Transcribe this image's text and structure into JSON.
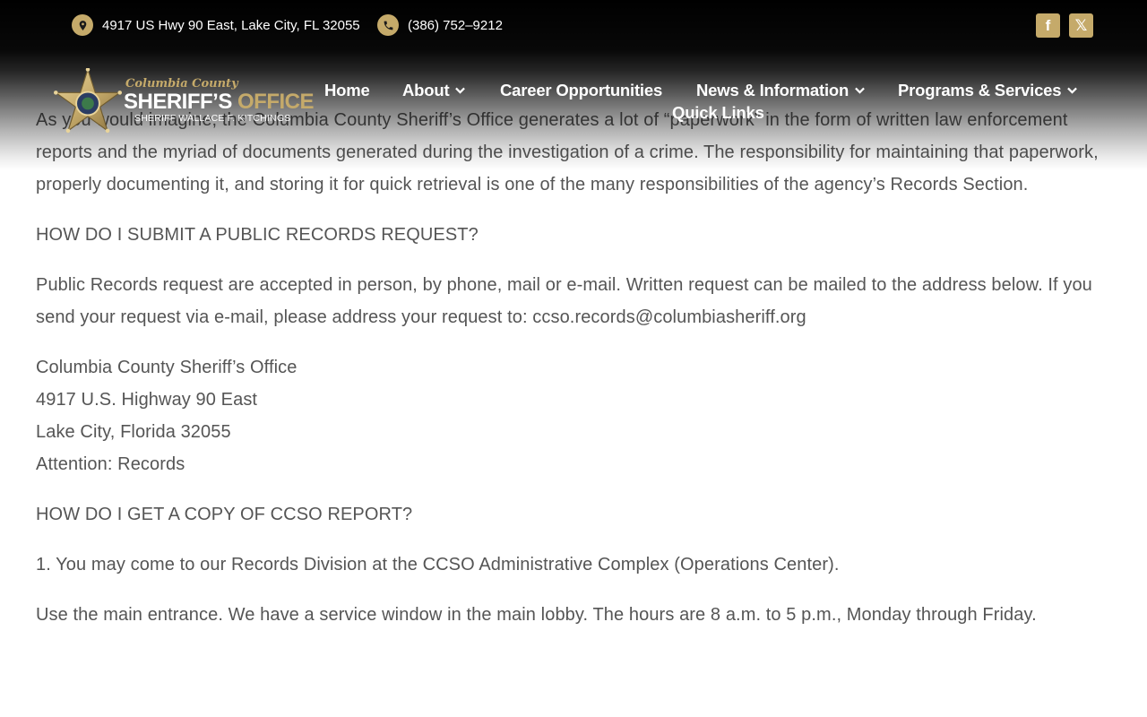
{
  "topbar": {
    "address": "4917 US Hwy 90 East, Lake City, FL 32055",
    "phone": "(386) 752–9212",
    "social": {
      "facebook": "f",
      "x": "𝕏"
    }
  },
  "logo": {
    "county": "Columbia County",
    "office_a": "SHERIFF’S ",
    "office_b": "OFFICE",
    "sheriff": "SHERIFF WALLACE F. KITCHINGS"
  },
  "nav": {
    "home": "Home",
    "about": "About",
    "career": "Career Opportunities",
    "news": "News & Information",
    "programs": "Programs & Services",
    "quick": "Quick Links"
  },
  "content": {
    "intro": "As you would imagine, the Columbia County Sheriff’s Office generates a lot of “paperwork” in the form of written law enforcement reports and the myriad of documents generated during the investigation of a crime. The responsibility for maintaining that paperwork, properly documenting it, and storing it for quick retrieval is one of the many responsibilities of the agency’s Records Section.",
    "q1": "HOW DO I SUBMIT A PUBLIC RECORDS REQUEST?",
    "a1": "Public Records request are accepted in person, by phone, mail or e-mail. Written request can be mailed to the address below. If you send your request via e-mail, please address your request to: ccso.records@columbiasheriff.org",
    "address": {
      "line1": "Columbia County Sheriff’s Office",
      "line2": "4917 U.S. Highway 90 East",
      "line3": "Lake City, Florida 32055",
      "line4": "Attention: Records"
    },
    "q2": "HOW DO I GET A COPY OF CCSO REPORT?",
    "a2": "1. You may come to our Records Division at the CCSO Administrative Complex (Operations Center).",
    "a3": "Use the main entrance. We have a service window in the main lobby. The hours are 8 a.m. to 5 p.m., Monday through Friday."
  },
  "colors": {
    "accent_gold": "#c5aa6a",
    "text": "#555555",
    "header_bg": "#000000"
  },
  "icons": {
    "address": "map-pin-icon",
    "phone": "phone-icon",
    "nav_dropdown": "chevron-down-icon"
  }
}
